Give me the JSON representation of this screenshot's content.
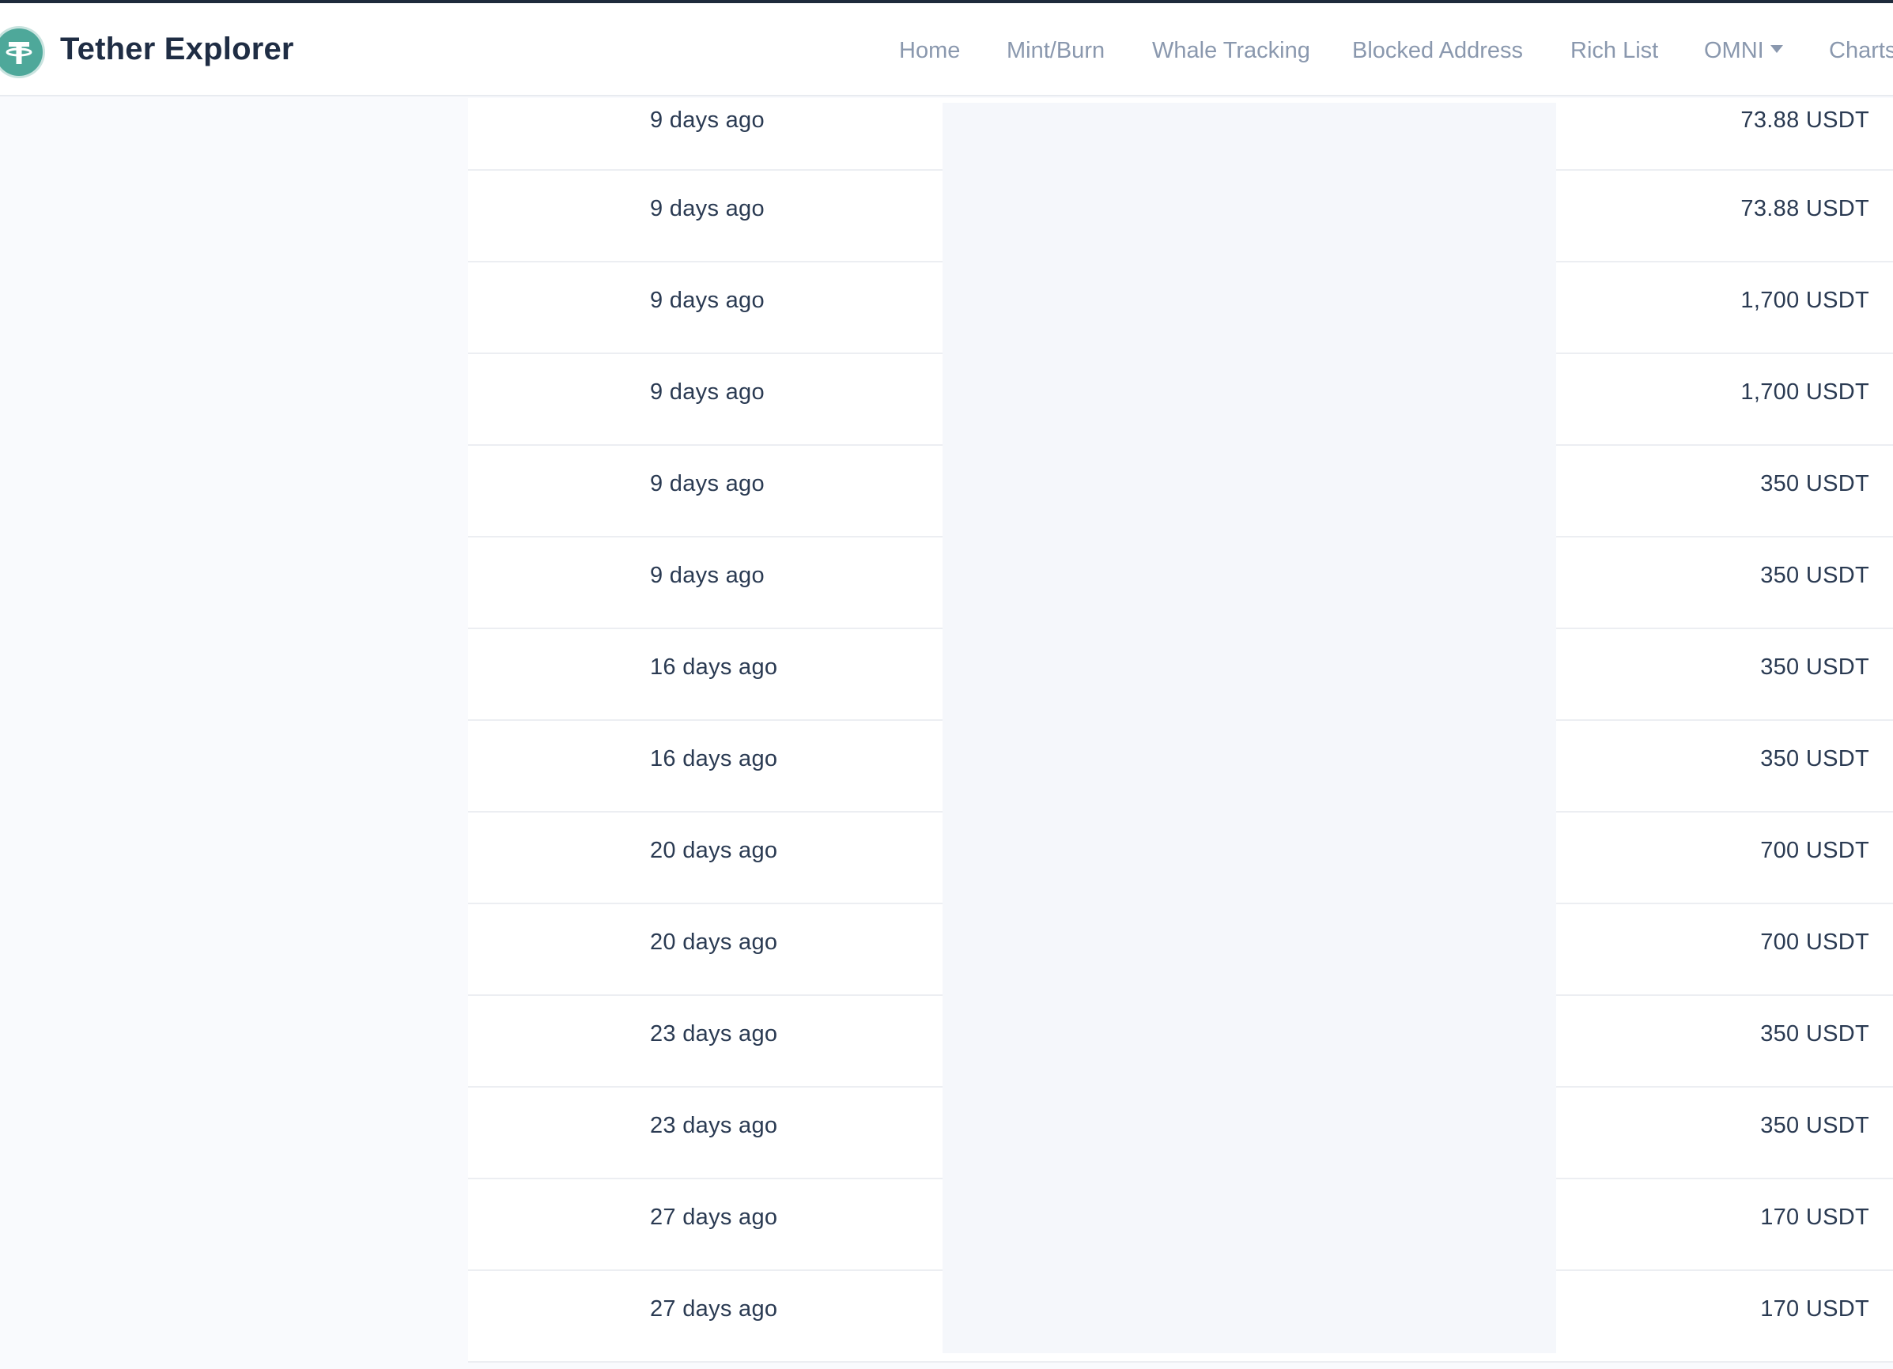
{
  "brand": {
    "name": "Tether Explorer",
    "logo_icon": "tether-logo-icon",
    "logo_color": "#4ea89a"
  },
  "nav": {
    "items": [
      {
        "label": "Home"
      },
      {
        "label": "Mint/Burn"
      },
      {
        "label": "Whale Tracking"
      },
      {
        "label": "Blocked Address"
      },
      {
        "label": "Rich List"
      },
      {
        "label": "OMNI",
        "dropdown_icon": "caret-down-icon"
      },
      {
        "label": "Charts"
      }
    ]
  },
  "table": {
    "rows": [
      {
        "time": "9 days ago",
        "amount": "73.88 USDT"
      },
      {
        "time": "9 days ago",
        "amount": "73.88 USDT"
      },
      {
        "time": "9 days ago",
        "amount": "1,700 USDT"
      },
      {
        "time": "9 days ago",
        "amount": "1,700 USDT"
      },
      {
        "time": "9 days ago",
        "amount": "350 USDT"
      },
      {
        "time": "9 days ago",
        "amount": "350 USDT"
      },
      {
        "time": "16 days ago",
        "amount": "350 USDT"
      },
      {
        "time": "16 days ago",
        "amount": "350 USDT"
      },
      {
        "time": "20 days ago",
        "amount": "700 USDT"
      },
      {
        "time": "20 days ago",
        "amount": "700 USDT"
      },
      {
        "time": "23 days ago",
        "amount": "350 USDT"
      },
      {
        "time": "23 days ago",
        "amount": "350 USDT"
      },
      {
        "time": "27 days ago",
        "amount": "170 USDT"
      },
      {
        "time": "27 days ago",
        "amount": "170 USDT"
      }
    ]
  }
}
